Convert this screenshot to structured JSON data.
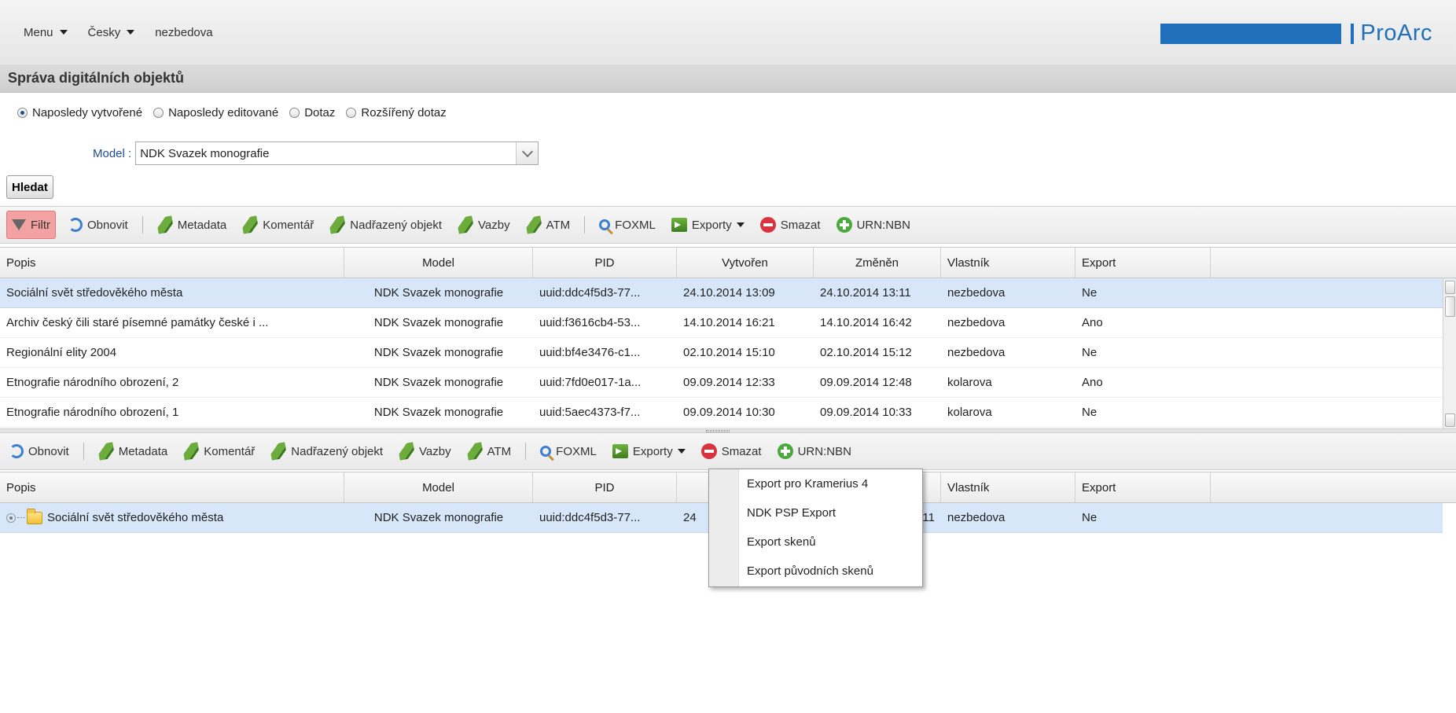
{
  "topnav": {
    "menu": "Menu",
    "language": "Česky",
    "user": "nezbedova"
  },
  "brand": {
    "name": "ProArc"
  },
  "page_title": "Správa digitálních objektů",
  "search": {
    "modes": [
      {
        "label": "Naposledy vytvořené",
        "selected": true
      },
      {
        "label": "Naposledy editované",
        "selected": false
      },
      {
        "label": "Dotaz",
        "selected": false
      },
      {
        "label": "Rozšířený dotaz",
        "selected": false
      }
    ],
    "model_label": "Model :",
    "model_value": "NDK Svazek monografie",
    "search_button": "Hledat"
  },
  "toolbar1": {
    "filter": "Filtr",
    "refresh": "Obnovit",
    "metadata": "Metadata",
    "comment": "Komentář",
    "parent": "Nadřazený objekt",
    "links": "Vazby",
    "atm": "ATM",
    "foxml": "FOXML",
    "exports": "Exporty",
    "delete": "Smazat",
    "urnnbn": "URN:NBN"
  },
  "toolbar2": {
    "refresh": "Obnovit",
    "metadata": "Metadata",
    "comment": "Komentář",
    "parent": "Nadřazený objekt",
    "links": "Vazby",
    "atm": "ATM",
    "foxml": "FOXML",
    "exports": "Exporty",
    "delete": "Smazat",
    "urnnbn": "URN:NBN"
  },
  "grid_headers": {
    "popis": "Popis",
    "model": "Model",
    "pid": "PID",
    "vytvoren": "Vytvořen",
    "zmenen": "Změněn",
    "vlastnik": "Vlastník",
    "export": "Export"
  },
  "grid1_rows": [
    {
      "popis": "Sociální svět středověkého města",
      "model": "NDK Svazek monografie",
      "pid": "uuid:ddc4f5d3-77...",
      "vytvoren": "24.10.2014 13:09",
      "zmenen": "24.10.2014 13:11",
      "vlastnik": "nezbedova",
      "export": "Ne"
    },
    {
      "popis": "Archiv český čili staré písemné památky české i ...",
      "model": "NDK Svazek monografie",
      "pid": "uuid:f3616cb4-53...",
      "vytvoren": "14.10.2014 16:21",
      "zmenen": "14.10.2014 16:42",
      "vlastnik": "nezbedova",
      "export": "Ano"
    },
    {
      "popis": "Regionální elity 2004",
      "model": "NDK Svazek monografie",
      "pid": "uuid:bf4e3476-c1...",
      "vytvoren": "02.10.2014 15:10",
      "zmenen": "02.10.2014 15:12",
      "vlastnik": "nezbedova",
      "export": "Ne"
    },
    {
      "popis": "Etnografie národního obrození, 2",
      "model": "NDK Svazek monografie",
      "pid": "uuid:7fd0e017-1a...",
      "vytvoren": "09.09.2014 12:33",
      "zmenen": "09.09.2014 12:48",
      "vlastnik": "kolarova",
      "export": "Ano"
    },
    {
      "popis": "Etnografie národního obrození, 1",
      "model": "NDK Svazek monografie",
      "pid": "uuid:5aec4373-f7...",
      "vytvoren": "09.09.2014 10:30",
      "zmenen": "09.09.2014 10:33",
      "vlastnik": "kolarova",
      "export": "Ne"
    }
  ],
  "grid2_row": {
    "popis": "Sociální svět středověkého města",
    "model": "NDK Svazek monografie",
    "pid": "uuid:ddc4f5d3-77...",
    "vytvoren_partial": "24",
    "zmenen_partial": "11",
    "vlastnik": "nezbedova",
    "export": "Ne"
  },
  "exports_menu": [
    "Export pro Kramerius 4",
    "NDK PSP Export",
    "Export skenů",
    "Export původních skenů"
  ],
  "colors": {
    "brand": "#1f6fba",
    "selection": "#d7e6f8",
    "filter_active": "#f2a2a2"
  }
}
